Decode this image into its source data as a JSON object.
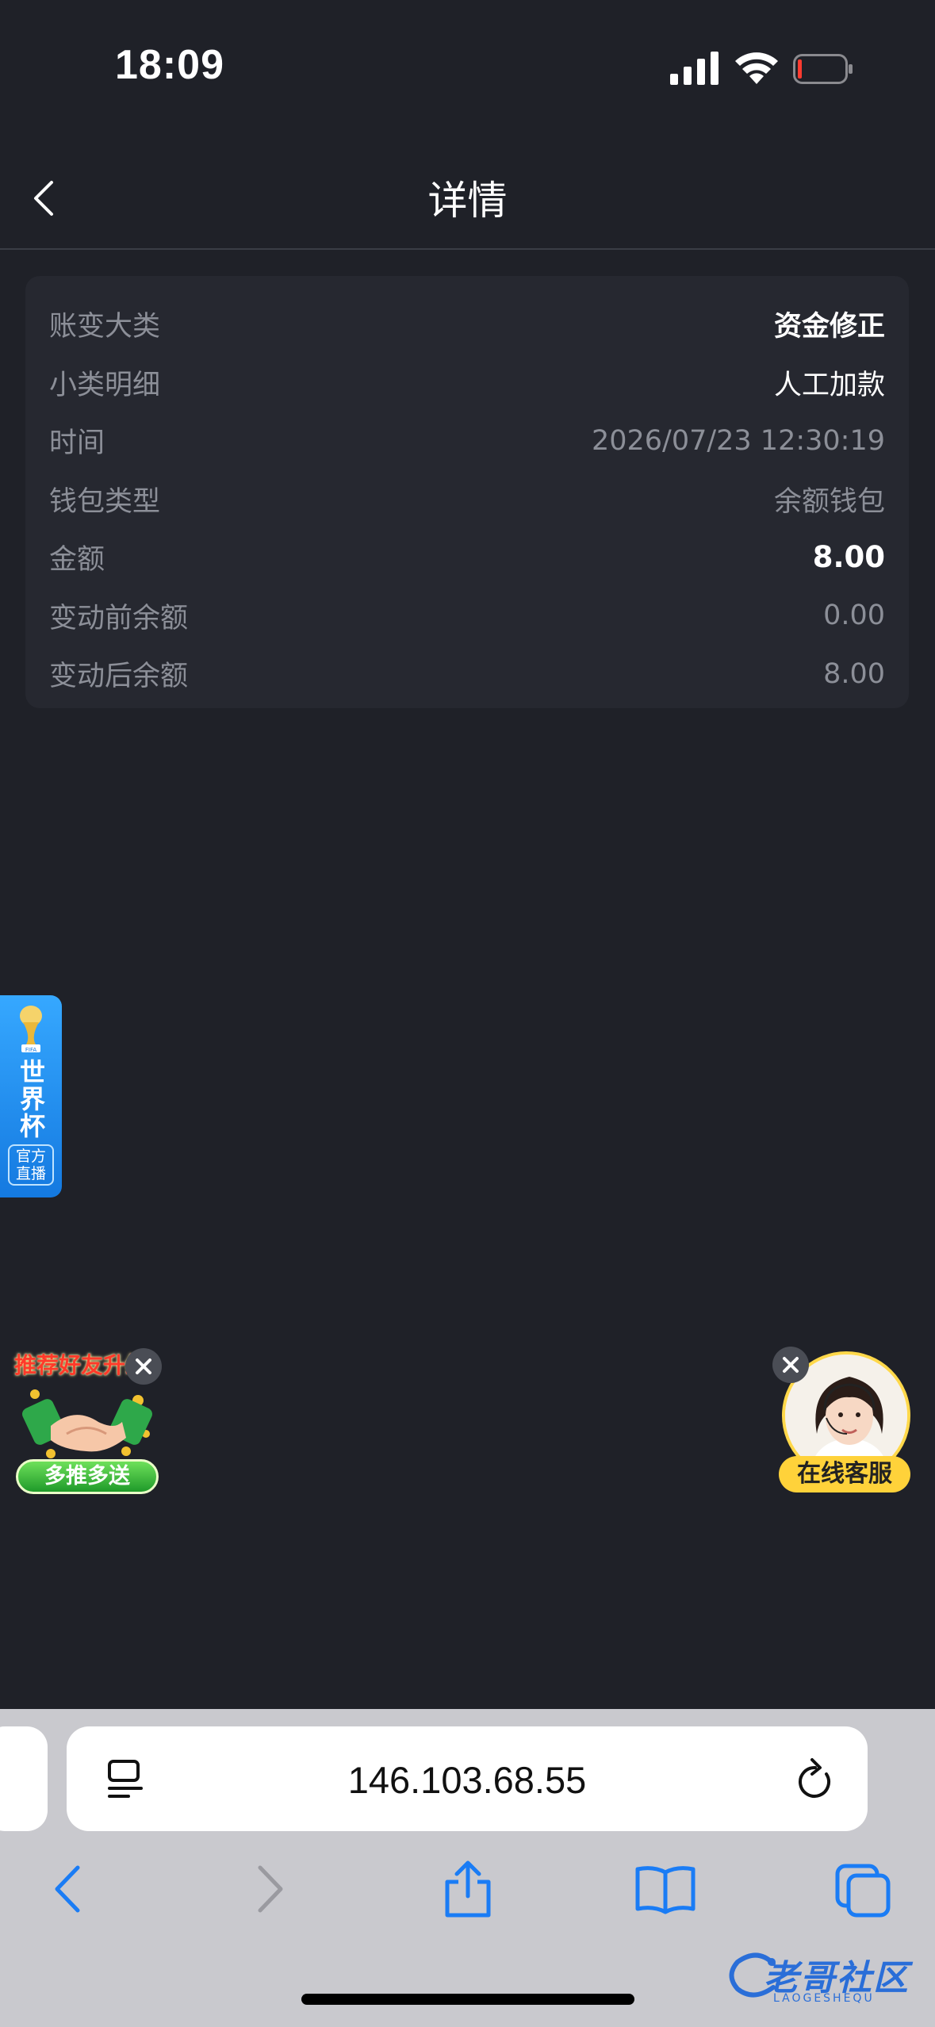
{
  "status_bar": {
    "time": "18:09"
  },
  "header": {
    "title": "详情"
  },
  "details": [
    {
      "label": "账变大类",
      "value": "资金修正",
      "style": "bold"
    },
    {
      "label": "小类明细",
      "value": "人工加款",
      "style": "white"
    },
    {
      "label": "时间",
      "value": "2026/07/23 12:30:19",
      "style": "muted"
    },
    {
      "label": "钱包类型",
      "value": "余额钱包",
      "style": "muted"
    },
    {
      "label": "金额",
      "value": "8.00",
      "style": "bold"
    },
    {
      "label": "变动前余额",
      "value": "0.00",
      "style": "muted"
    },
    {
      "label": "变动后余额",
      "value": "8.00",
      "style": "muted"
    }
  ],
  "floating": {
    "worldcup_title": "世界杯",
    "worldcup_sub_1": "官方",
    "worldcup_sub_2": "直播",
    "referral_title": "推荐好友升级",
    "referral_button": "多推多送",
    "support_label": "在线客服"
  },
  "browser": {
    "address": "146.103.68.55"
  },
  "watermark": {
    "text": "老哥社区",
    "sub": "LAOGESHEQU"
  },
  "colors": {
    "background": "#1f2128",
    "card": "#262830",
    "muted_text": "#8c8f98",
    "safari_blue": "#1a7cf5"
  }
}
